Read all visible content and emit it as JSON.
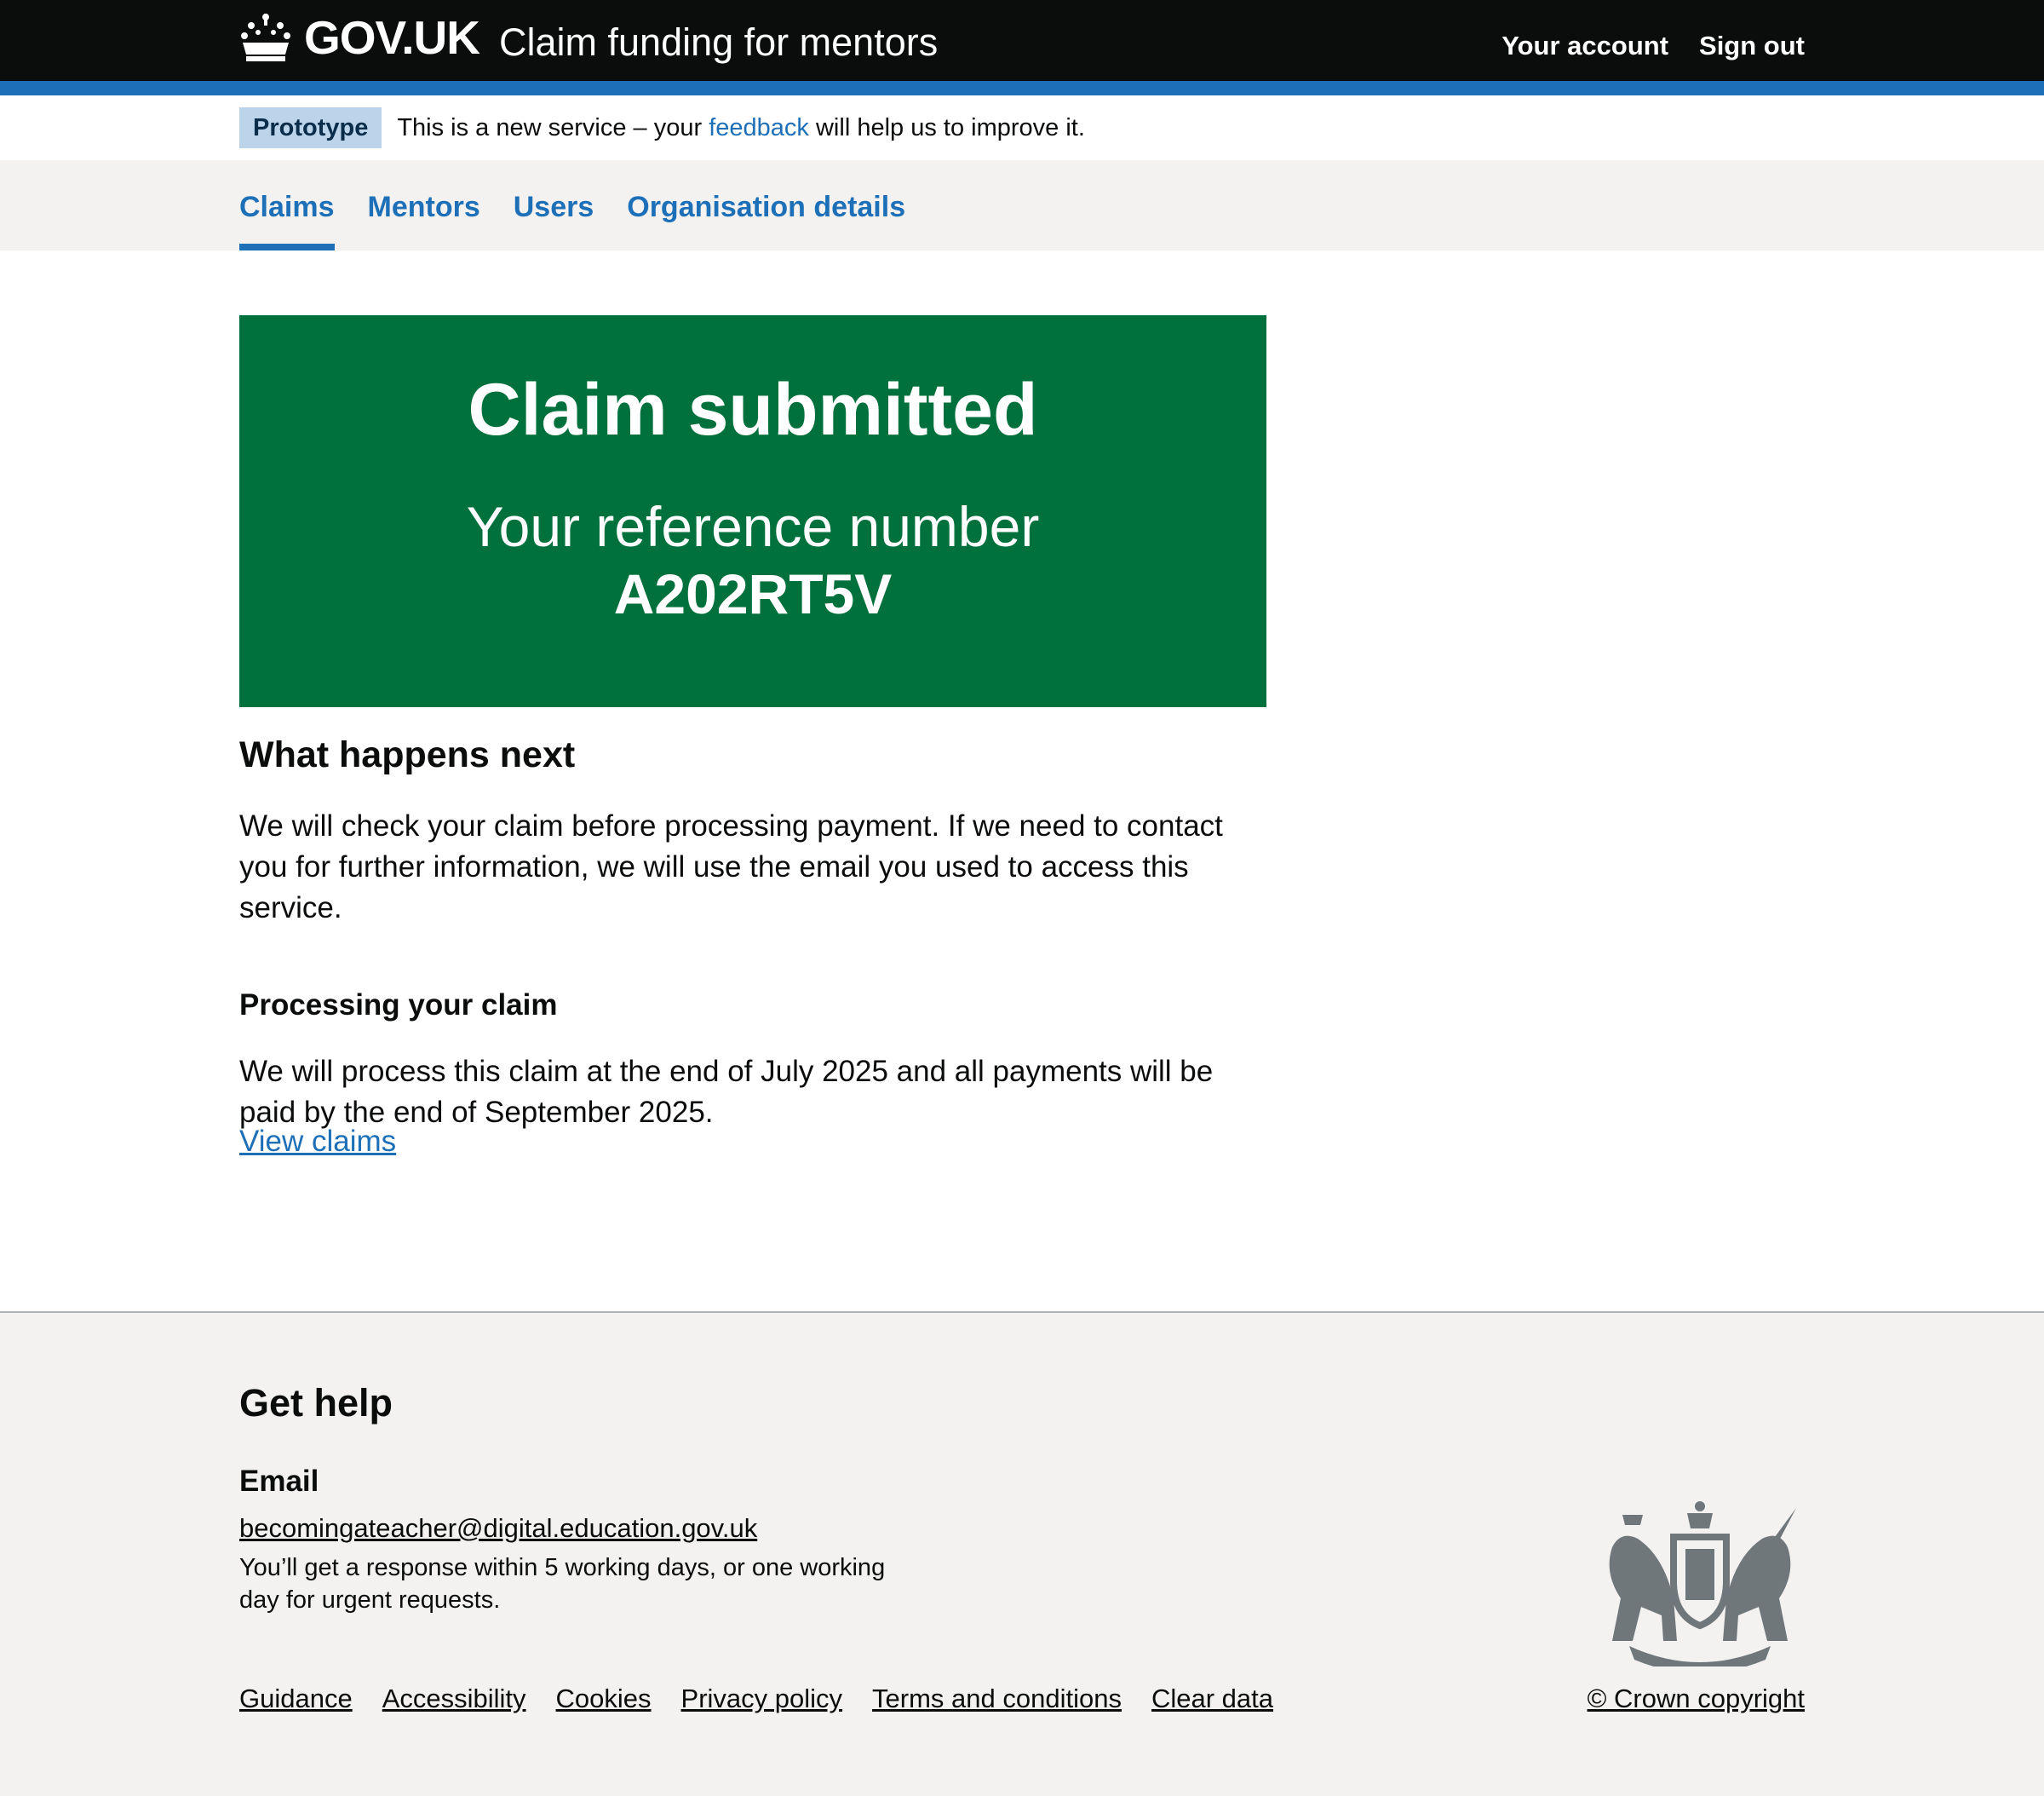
{
  "header": {
    "logotype": "GOV.UK",
    "service_name": "Claim funding for mentors",
    "nav": {
      "your_account": "Your account",
      "sign_out": "Sign out"
    }
  },
  "phase_banner": {
    "tag": "Prototype",
    "text_before": "This is a new service – your",
    "link": "feedback",
    "text_after": "will help us to improve it."
  },
  "subnav": {
    "items": [
      {
        "label": "Claims",
        "current": true
      },
      {
        "label": "Mentors"
      },
      {
        "label": "Users"
      },
      {
        "label": "Organisation details"
      }
    ]
  },
  "panel": {
    "title": "Claim submitted",
    "body": "Your reference number",
    "reference": "A202RT5V"
  },
  "content": {
    "heading": "What happens next",
    "para1": "We will check your claim before processing payment. If we need to contact you for further information, we will use the email you used to access this service.",
    "subheading": "Processing your claim",
    "para2": "We will process this claim at the end of July 2025 and all payments will be paid by the end of September 2025.",
    "link": "View claims"
  },
  "footer": {
    "heading": "Get help",
    "email_heading": "Email",
    "email": "becomingateacher@digital.education.gov.uk",
    "note": "You’ll get a response within 5 working days, or one working day for urgent requests.",
    "links": [
      "Guidance",
      "Accessibility",
      "Cookies",
      "Privacy policy",
      "Terms and conditions",
      "Clear data"
    ],
    "copyright": "© Crown copyright",
    "crest_icon": "royal-coat-of-arms-icon"
  },
  "colors": {
    "header_bg": "#0b0c0c",
    "brand_blue": "#1d70b8",
    "panel_green": "#00703c",
    "footer_bg": "#f3f2f1",
    "tag_bg": "#bbd4ea"
  }
}
